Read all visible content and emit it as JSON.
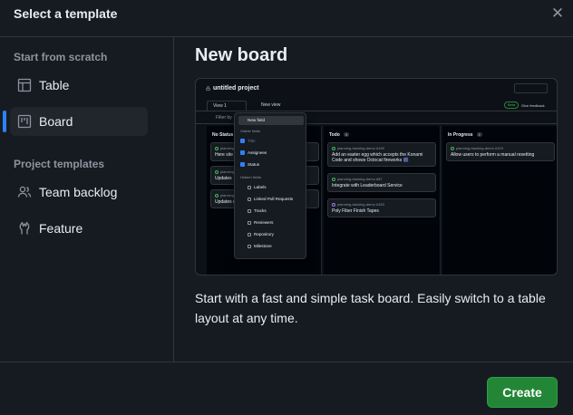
{
  "dialog": {
    "title": "Select a template",
    "close_icon": "close-icon"
  },
  "sidebar": {
    "scratch_label": "Start from scratch",
    "scratch_items": [
      {
        "label": "Table",
        "icon": "table-icon"
      },
      {
        "label": "Board",
        "icon": "board-icon",
        "selected": true
      }
    ],
    "templates_label": "Project templates",
    "template_items": [
      {
        "label": "Team backlog",
        "icon": "people-icon"
      },
      {
        "label": "Feature",
        "icon": "feature-icon"
      }
    ]
  },
  "main": {
    "title": "New board",
    "description": "Start with a fast and simple task board. Easily switch to a table layout at any time."
  },
  "preview": {
    "project_title": "untitled project",
    "tab_view": "View 1",
    "tab_new": "New view",
    "badge_beta": "Beta",
    "give_feedback": "Give feedback",
    "filter": "Filter by",
    "columns": [
      {
        "title": "No Status",
        "cards": [
          {
            "repo": "planning",
            "title": "Here site"
          },
          {
            "repo": "planning",
            "title": "Updates"
          },
          {
            "repo": "planning",
            "title": "Updates d"
          }
        ]
      },
      {
        "title": "Todo",
        "count": "3",
        "cards": [
          {
            "repo": "planning-tracking-demo #190",
            "title": "Add an easter egg which accepts the Konami Code and shows Octocat fireworks 🎆"
          },
          {
            "repo": "planning-tracking-demo #87",
            "title": "Integrate with Leaderboard Service"
          },
          {
            "repo": "planning-tracking-demo #183",
            "title": "Poly Fiber Finish Tapes"
          }
        ]
      },
      {
        "title": "In Progress",
        "count": "1",
        "cards": [
          {
            "repo": "planning-tracking-demo #103",
            "title": "Allow users to perform a manual resetting"
          }
        ]
      }
    ],
    "menu": {
      "new_field": "New field",
      "visible_header": "Visible fields",
      "visible_items": [
        "Title",
        "Assignees",
        "Status"
      ],
      "hidden_header": "Hidden fields",
      "hidden_items": [
        "Labels",
        "Linked Pull Requests",
        "Tracks",
        "Reviewers",
        "Repository",
        "Milestone"
      ]
    }
  },
  "footer": {
    "create_label": "Create"
  },
  "colors": {
    "background": "#161b22",
    "border": "#30363d",
    "accent": "#2f81f7",
    "create": "#238636"
  }
}
